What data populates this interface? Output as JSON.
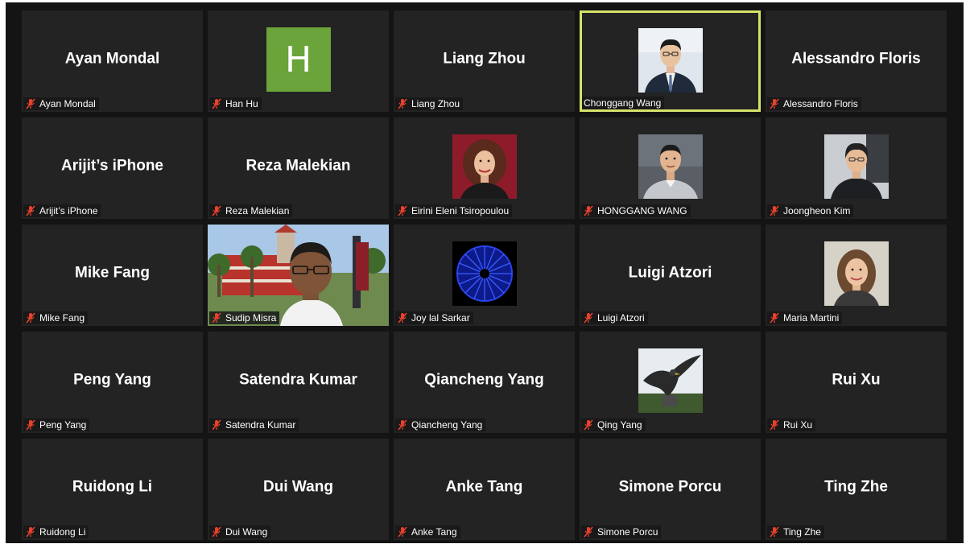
{
  "participants": [
    {
      "big": "Ayan Mondal",
      "label": "Ayan Mondal"
    },
    {
      "big": "",
      "label": "Han Hu",
      "avatar_letter": "H"
    },
    {
      "big": "Liang Zhou",
      "label": "Liang Zhou"
    },
    {
      "big": "",
      "label": "Chonggang Wang"
    },
    {
      "big": "Alessandro Floris",
      "label": "Alessandro Floris"
    },
    {
      "big": "Arijit’s iPhone",
      "label": "Arijit’s iPhone"
    },
    {
      "big": "Reza Malekian",
      "label": "Reza Malekian"
    },
    {
      "big": "",
      "label": "Eirini Eleni Tsiropoulou"
    },
    {
      "big": "",
      "label": "HONGGANG WANG"
    },
    {
      "big": "",
      "label": "Joongheon Kim"
    },
    {
      "big": "Mike Fang",
      "label": "Mike Fang"
    },
    {
      "big": "",
      "label": "Sudip Misra"
    },
    {
      "big": "",
      "label": "Joy  lal Sarkar"
    },
    {
      "big": "Luigi Atzori",
      "label": "Luigi Atzori"
    },
    {
      "big": "",
      "label": "Maria Martini"
    },
    {
      "big": "Peng Yang",
      "label": "Peng Yang"
    },
    {
      "big": "Satendra Kumar",
      "label": "Satendra Kumar"
    },
    {
      "big": "Qiancheng Yang",
      "label": "Qiancheng Yang"
    },
    {
      "big": "",
      "label": "Qing Yang"
    },
    {
      "big": "Rui Xu",
      "label": "Rui Xu"
    },
    {
      "big": "Ruidong Li",
      "label": "Ruidong Li"
    },
    {
      "big": "Dui Wang",
      "label": "Dui Wang"
    },
    {
      "big": "Anke Tang",
      "label": "Anke Tang"
    },
    {
      "big": "Simone Porcu",
      "label": "Simone Porcu"
    },
    {
      "big": "Ting Zhe",
      "label": "Ting Zhe"
    }
  ],
  "colors": {
    "background": "#141414",
    "tile": "#232323",
    "active_speaker_border": "#d6e36a",
    "mute_icon": "#e8412c",
    "avatar_green": "#6aa43a"
  },
  "icons": {
    "mute": "microphone-muted-icon"
  }
}
